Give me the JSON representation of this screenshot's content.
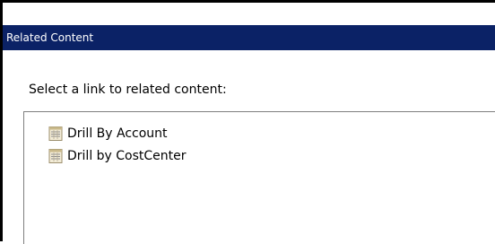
{
  "dialog": {
    "title": "Related Content",
    "prompt": "Select a link to related content:"
  },
  "links": [
    {
      "label": "Drill By Account",
      "icon": "report-icon"
    },
    {
      "label": "Drill by CostCenter",
      "icon": "report-icon"
    }
  ],
  "colors": {
    "titlebar_bg": "#0b2266",
    "titlebar_text": "#ffffff",
    "border": "#000000",
    "listbox_border": "#7f7f7f"
  }
}
